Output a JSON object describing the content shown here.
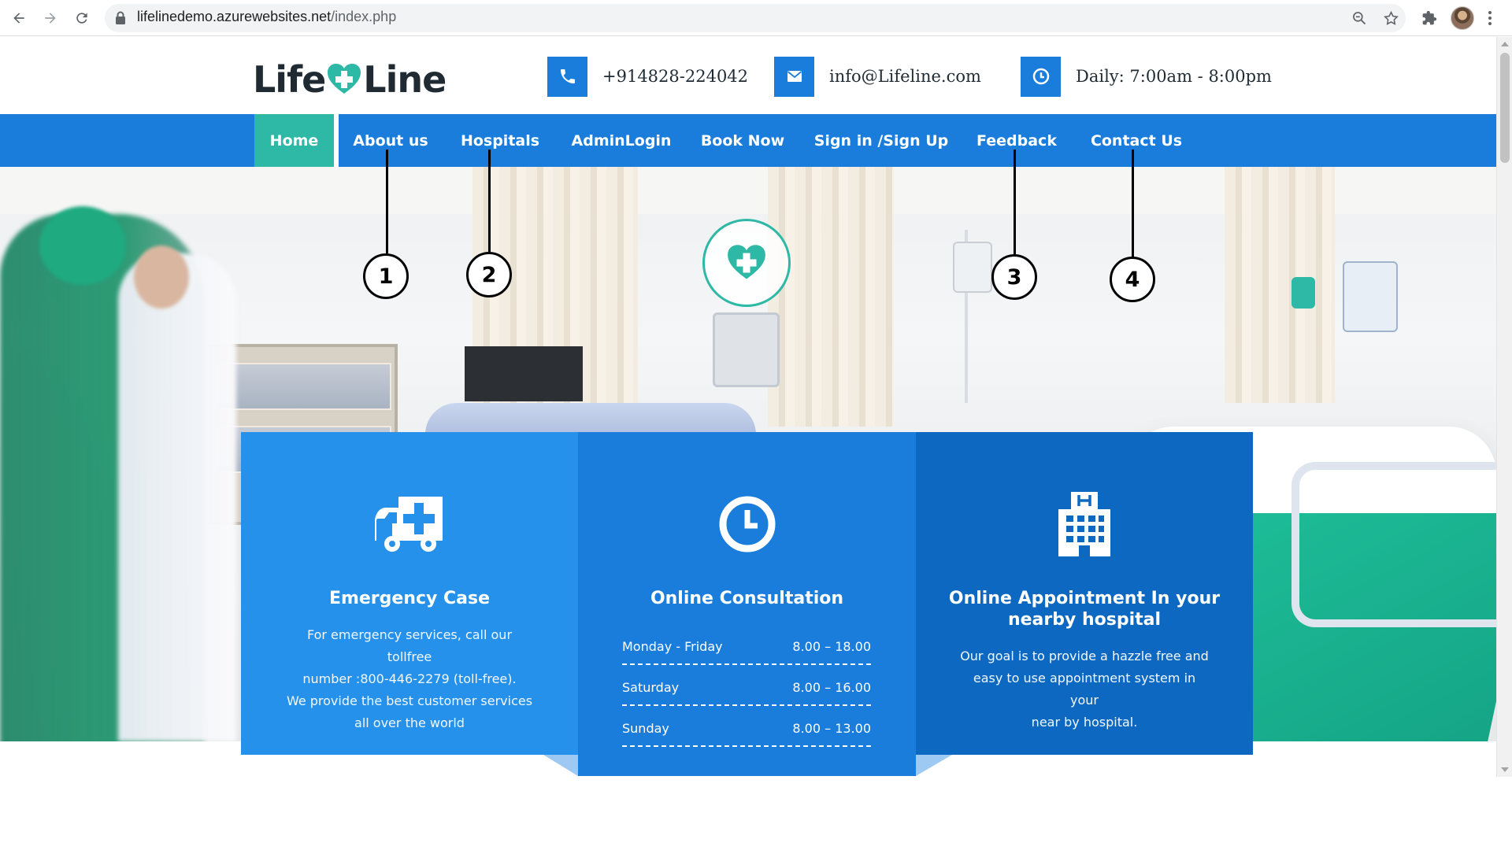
{
  "browser": {
    "url_domain": "lifelinedemo.azurewebsites.net",
    "url_path": "/index.php"
  },
  "header": {
    "logo_part1": "Life",
    "logo_part2": "Line",
    "phone": "+914828-224042",
    "email": "info@Lifeline.com",
    "hours": "Daily: 7:00am - 8:00pm"
  },
  "nav": {
    "items": [
      {
        "label": "Home",
        "active": true
      },
      {
        "label": "About us"
      },
      {
        "label": "Hospitals"
      },
      {
        "label": "AdminLogin"
      },
      {
        "label": "Book Now"
      },
      {
        "label": "Sign in /Sign Up"
      },
      {
        "label": "Feedback"
      },
      {
        "label": "Contact Us"
      }
    ]
  },
  "callouts": [
    "1",
    "2",
    "3",
    "4"
  ],
  "cards": {
    "emergency": {
      "icon": "ambulance-icon",
      "title": "Emergency Case",
      "text_line1": "For emergency services, call our tollfree",
      "text_line2": "number :800-446-2279 (toll-free).",
      "text_line3": "We provide the best customer services",
      "text_line4": "all over the world"
    },
    "consultation": {
      "icon": "clock-icon",
      "title": "Online Consultation",
      "hours": [
        {
          "day": "Monday - Friday",
          "time": "8.00 – 18.00"
        },
        {
          "day": "Saturday",
          "time": "8.00 – 16.00"
        },
        {
          "day": "Sunday",
          "time": "8.00 – 13.00"
        }
      ]
    },
    "appointment": {
      "icon": "hospital-building-icon",
      "title_line1": "Online Appointment In your",
      "title_line2": "nearby hospital",
      "text_line1": "Our goal is to provide a hazzle free and",
      "text_line2": "easy to use appointment system in your",
      "text_line3": "near by hospital."
    }
  },
  "colors": {
    "primary_blue": "#1a7ddc",
    "card_light_blue": "#2591ea",
    "card_dark_blue": "#0d68c2",
    "teal_accent": "#2eb8a6"
  }
}
